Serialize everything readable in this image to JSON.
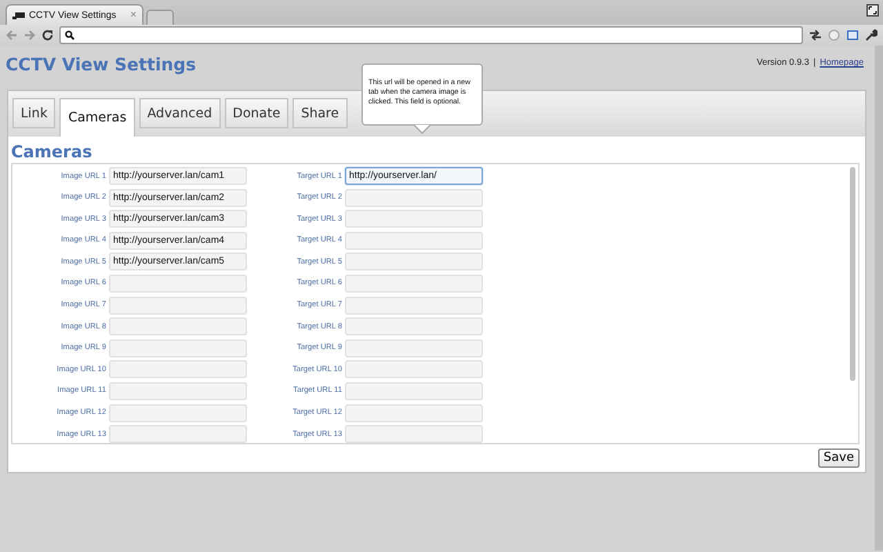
{
  "browser": {
    "tab_title": "CCTV View Settings",
    "tab_close": "×"
  },
  "page": {
    "title": "CCTV View Settings",
    "version": "Version 0.9.3",
    "separator": "|",
    "homepage_link": "Homepage"
  },
  "tabs": [
    {
      "label": "Link",
      "selected": false
    },
    {
      "label": "Cameras",
      "selected": true
    },
    {
      "label": "Advanced",
      "selected": false
    },
    {
      "label": "Donate",
      "selected": false
    },
    {
      "label": "Share",
      "selected": false
    }
  ],
  "tooltip": "This url will be opened in a new tab when the camera image is clicked. This field is optional.",
  "section_title": "Cameras",
  "rows": [
    {
      "image_label": "Image URL 1",
      "image_value": "http://yourserver.lan/cam1",
      "target_label": "Target URL 1",
      "target_value": "http://yourserver.lan/",
      "focused": true
    },
    {
      "image_label": "Image URL 2",
      "image_value": "http://yourserver.lan/cam2",
      "target_label": "Target URL 2",
      "focused": false
    },
    {
      "image_label": "Image URL 3",
      "image_value": "http://yourserver.lan/cam3",
      "target_label": "Target URL 3",
      "focused": false
    },
    {
      "image_label": "Image URL 4",
      "image_value": "http://yourserver.lan/cam4",
      "target_label": "Target URL 4",
      "focused": false
    },
    {
      "image_label": "Image URL 5",
      "image_value": "http://yourserver.lan/cam5",
      "target_label": "Target URL 5",
      "focused": false
    },
    {
      "image_label": "Image URL 6",
      "target_label": "Target URL 6",
      "focused": false
    },
    {
      "image_label": "Image URL 7",
      "target_label": "Target URL 7",
      "focused": false
    },
    {
      "image_label": "Image URL 8",
      "target_label": "Target URL 8",
      "focused": false
    },
    {
      "image_label": "Image URL 9",
      "target_label": "Target URL 9",
      "focused": false
    },
    {
      "image_label": "Image URL 10",
      "target_label": "Target URL 10",
      "focused": false
    },
    {
      "image_label": "Image URL 11",
      "target_label": "Target URL 11",
      "focused": false
    },
    {
      "image_label": "Image URL 12",
      "target_label": "Target URL 12",
      "focused": false
    },
    {
      "image_label": "Image URL 13",
      "target_label": "Target URL 13",
      "focused": false
    }
  ],
  "save_button": "Save"
}
